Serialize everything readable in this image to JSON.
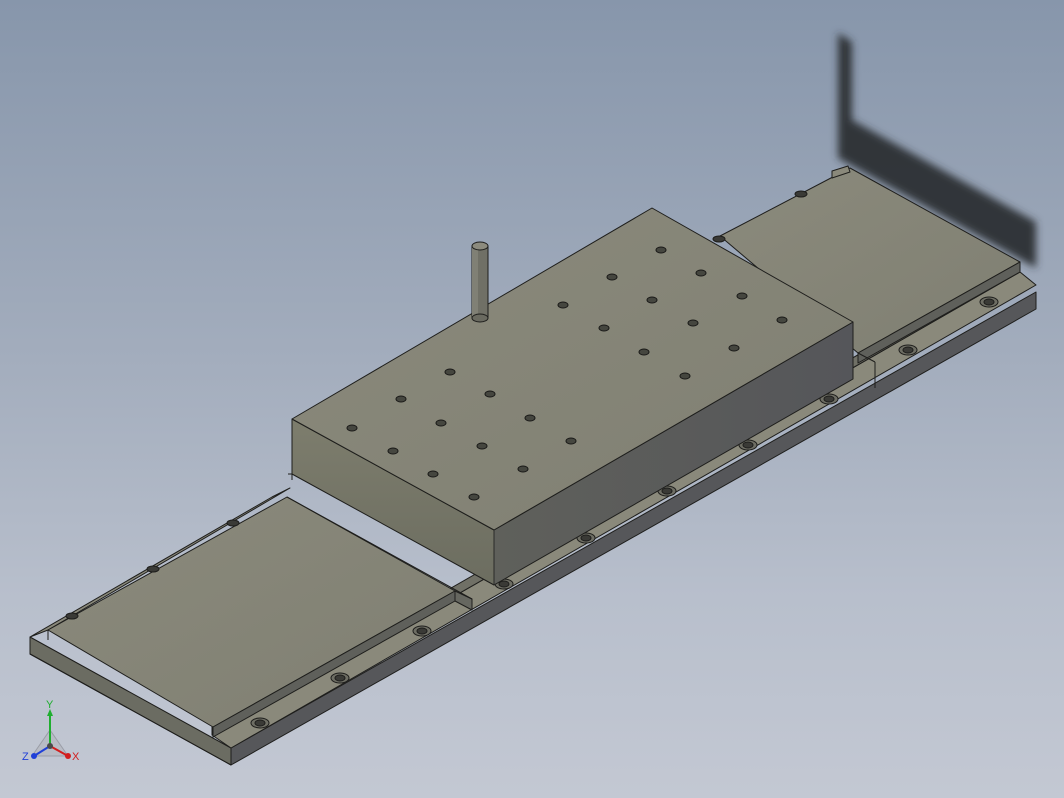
{
  "viewport": {
    "background_top": "#8796ab",
    "background_bottom": "#c3c8d3"
  },
  "model": {
    "face_top_color": "#8d8c7e",
    "face_front_color": "#77786a",
    "face_side_color": "#5e5f58",
    "edge_color": "#1e1e1c",
    "shadow_color": "#2a3036",
    "parts": [
      "base-rail",
      "end-plate-front",
      "end-plate-rear",
      "carriage-block",
      "locating-pin",
      "cable-bracket"
    ]
  },
  "view_cube": {
    "x_label": "X",
    "y_label": "Y",
    "z_label": "Z",
    "x_color": "#d21e1e",
    "y_color": "#1fae2f",
    "z_color": "#2040d8"
  }
}
